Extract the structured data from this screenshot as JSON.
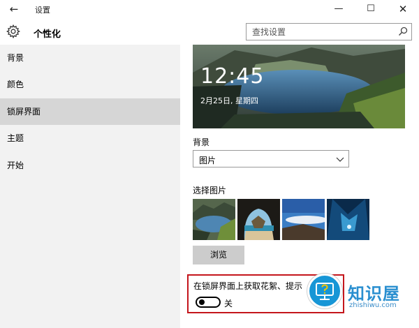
{
  "window": {
    "title": "设置",
    "back_glyph": "←",
    "minimize_glyph": "—",
    "maximize_glyph": "☐",
    "close_glyph": "✕"
  },
  "header": {
    "icon": "gear-icon",
    "title": "个性化",
    "search_placeholder": "查找设置",
    "search_icon": "search-icon"
  },
  "sidebar": {
    "items": [
      {
        "label": "背景",
        "active": false
      },
      {
        "label": "颜色",
        "active": false
      },
      {
        "label": "锁屏界面",
        "active": true
      },
      {
        "label": "主题",
        "active": false
      },
      {
        "label": "开始",
        "active": false
      }
    ]
  },
  "lock_preview": {
    "time": "12:45",
    "date": "2月25日, 星期四"
  },
  "background": {
    "label": "背景",
    "selected": "图片"
  },
  "choose_picture": {
    "label": "选择图片",
    "thumbnails": [
      "lake-mountains",
      "cave-beach",
      "desert-sky",
      "ice-cave"
    ]
  },
  "browse_label": "浏览",
  "spotlight": {
    "label": "在锁屏界面上获取花絮、提示",
    "toggle_state": "关",
    "enabled": false
  },
  "watermark": {
    "title": "知识屋",
    "subtitle": "zhishiwu.com"
  },
  "colors": {
    "accent_border": "#c4161c",
    "sidebar_bg": "#f2f2f2",
    "active_item_bg": "#d6d6d6",
    "watermark_blue": "#1796d6"
  }
}
